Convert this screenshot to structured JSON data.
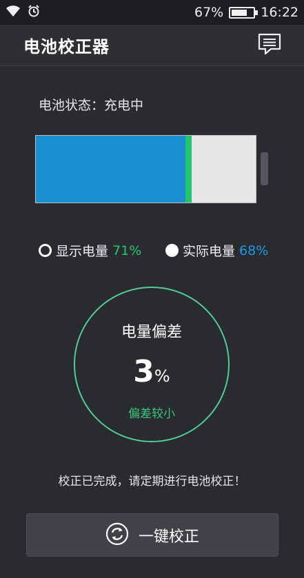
{
  "status_bar": {
    "battery_percent": "67%",
    "time": "16:22",
    "icons": [
      "wifi-icon",
      "alarm-icon",
      "battery-icon"
    ]
  },
  "header": {
    "title": "电池校正器",
    "feedback_icon": "message-icon"
  },
  "battery": {
    "status_label": "电池状态：充电中",
    "display_level": 0.71,
    "actual_level": 0.68,
    "actual_color": "#1a8fd1",
    "display_marker_color": "#25c56c"
  },
  "legend": {
    "display_label": "显示电量",
    "display_value": "71%",
    "actual_label": "实际电量",
    "actual_value": "68%"
  },
  "deviation": {
    "title": "电量偏差",
    "value": "3",
    "unit": "%",
    "note": "偏差较小"
  },
  "message": "校正已完成，请定期进行电池校正！",
  "action": {
    "label": "一键校正",
    "icon": "refresh-icon"
  }
}
